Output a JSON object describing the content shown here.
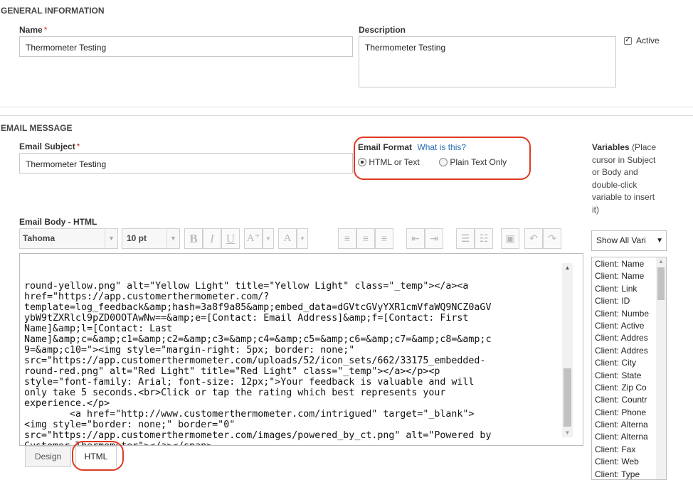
{
  "general": {
    "section_title": "GENERAL INFORMATION",
    "name_label": "Name",
    "required_mark": "*",
    "name_value": "Thermometer Testing",
    "description_label": "Description",
    "description_value": "Thermometer Testing",
    "active_label": "Active",
    "active_checked": true
  },
  "email": {
    "section_title": "EMAIL MESSAGE",
    "subject_label": "Email Subject",
    "subject_value": "Thermometer Testing",
    "format_label": "Email Format",
    "format_help_link": "What is this?",
    "format_options": [
      {
        "label": "HTML or Text",
        "selected": true
      },
      {
        "label": "Plain Text Only",
        "selected": false
      }
    ],
    "body_label": "Email Body - HTML",
    "font_family": "Tahoma",
    "font_size": "10 pt",
    "body_lines": [
      "round-yellow.png\" alt=\"Yellow Light\" title=\"Yellow Light\" class=\"_temp\"></a><a",
      "href=\"https://app.customerthermometer.com/?",
      "template=log_feedback&amp;hash=3a8f9a85&amp;embed_data=dGVtcGVyYXR1cmVfaWQ9NCZ0aGV",
      "ybW9tZXRlcl9pZD0OOTAwNw==&amp;e=[Contact: Email Address]&amp;f=[Contact: First",
      "Name]&amp;l=[Contact: Last",
      "Name]&amp;c=&amp;c1=&amp;c2=&amp;c3=&amp;c4=&amp;c5=&amp;c6=&amp;c7=&amp;c8=&amp;c",
      "9=&amp;c10=\"><img style=\"margin-right: 5px; border: none;\"",
      "src=\"https://app.customerthermometer.com/uploads/52/icon_sets/662/33175_embedded-",
      "round-red.png\" alt=\"Red Light\" title=\"Red Light\" class=\"_temp\"></a></p><p",
      "style=\"font-family: Arial; font-size: 12px;\">Your feedback is valuable and will",
      "only take 5 seconds.<br>Click or tap the rating which best represents your",
      "experience.</p>",
      "        <a href=\"http://www.customerthermometer.com/intrigued\" target=\"_blank\">",
      "<img style=\"border: none;\" border=\"0\"",
      "src=\"https://app.customerthermometer.com/images/powered_by_ct.png\" alt=\"Powered by",
      "Customer Thermometer\"></a></span>"
    ],
    "tabs": [
      {
        "label": "Design",
        "active": false
      },
      {
        "label": "HTML",
        "active": true
      }
    ]
  },
  "variables": {
    "title": "Variables",
    "hint": "(Place cursor in Subject or Body and double-click variable to insert it)",
    "filter_value": "Show All Vari",
    "items": [
      "Client: Name",
      "Client: Name",
      "Client: Link",
      "Client: ID",
      "Client: Numbe",
      "Client: Active",
      "Client: Addres",
      "Client: Addres",
      "Client: City",
      "Client: State",
      "Client: Zip Co",
      "Client: Countr",
      "Client: Phone",
      "Client: Alterna",
      "Client: Alterna",
      "Client: Fax",
      "Client: Web",
      "Client: Type"
    ]
  },
  "colors": {
    "required": "#d9262c",
    "link": "#2a6db5",
    "highlight": "#e03a22"
  }
}
